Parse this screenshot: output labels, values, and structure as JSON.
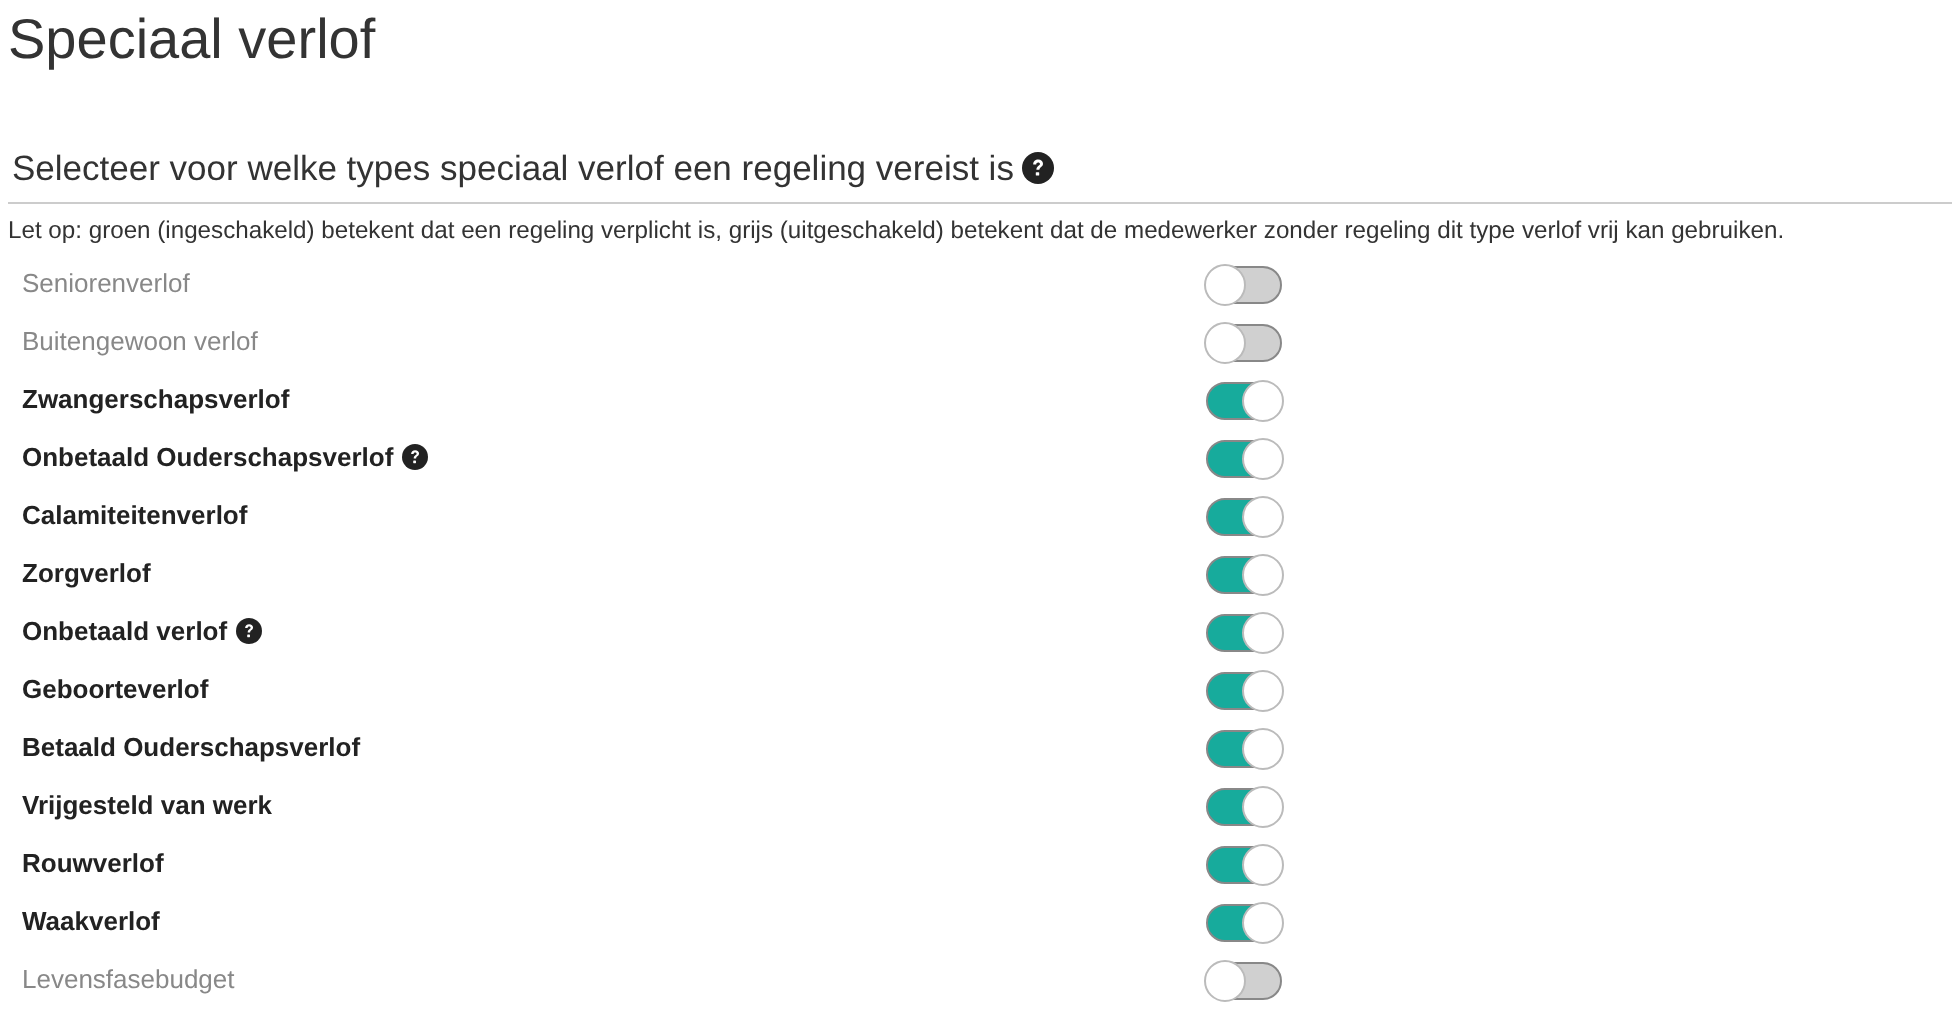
{
  "page": {
    "title": "Speciaal verlof"
  },
  "section": {
    "title": "Selecteer voor welke types speciaal verlof een regeling vereist is",
    "help": true,
    "note": "Let op: groen (ingeschakeld) betekent dat een regeling verplicht is, grijs (uitgeschakeld) betekent dat de medewerker zonder regeling dit type verlof vrij kan gebruiken."
  },
  "leave_types": [
    {
      "label": "Seniorenverlof",
      "help": false,
      "on": false
    },
    {
      "label": "Buitengewoon verlof",
      "help": false,
      "on": false
    },
    {
      "label": "Zwangerschapsverlof",
      "help": false,
      "on": true
    },
    {
      "label": "Onbetaald Ouderschapsverlof",
      "help": true,
      "on": true
    },
    {
      "label": "Calamiteitenverlof",
      "help": false,
      "on": true
    },
    {
      "label": "Zorgverlof",
      "help": false,
      "on": true
    },
    {
      "label": "Onbetaald verlof",
      "help": true,
      "on": true
    },
    {
      "label": "Geboorteverlof",
      "help": false,
      "on": true
    },
    {
      "label": "Betaald Ouderschapsverlof",
      "help": false,
      "on": true
    },
    {
      "label": "Vrijgesteld van werk",
      "help": false,
      "on": true
    },
    {
      "label": "Rouwverlof",
      "help": false,
      "on": true
    },
    {
      "label": "Waakverlof",
      "help": false,
      "on": true
    },
    {
      "label": "Levensfasebudget",
      "help": false,
      "on": false
    }
  ]
}
